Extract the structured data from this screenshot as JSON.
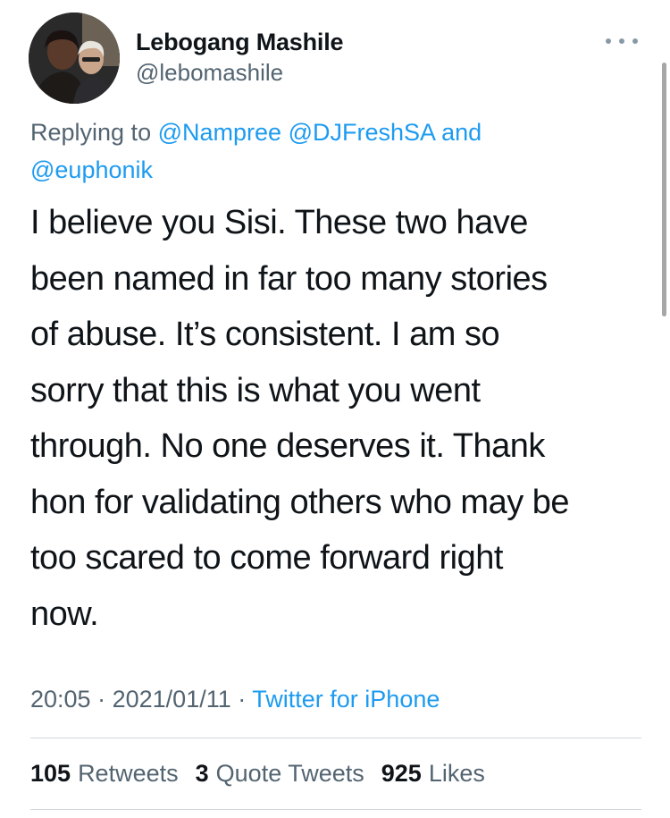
{
  "author": {
    "display_name": "Lebogang Mashile",
    "handle": "@lebomashile",
    "avatar_icon": "profile-photo"
  },
  "reply": {
    "prefix": "Replying to",
    "mentions": [
      "@Nampree",
      "@DJFreshSA",
      "@euphonik"
    ],
    "conjunction": "and"
  },
  "tweet": {
    "text": "I believe you Sisi. These two have\nbeen named in far too many stories\nof abuse. It’s consistent. I am so\nsorry that this is what you went\nthrough. No one deserves it. Thank\nhon for validating others who may be\ntoo scared to come forward right\nnow."
  },
  "meta": {
    "time": "20:05",
    "date": "2021/01/11",
    "source": "Twitter for iPhone",
    "separator": "·"
  },
  "stats": {
    "retweets_count": "105",
    "retweets_label": "Retweets",
    "quotes_count": "3",
    "quotes_label": "Quote Tweets",
    "likes_count": "925",
    "likes_label": "Likes"
  },
  "colors": {
    "link": "#1d9bf0",
    "secondary": "#536471",
    "primary": "#0f1419"
  }
}
